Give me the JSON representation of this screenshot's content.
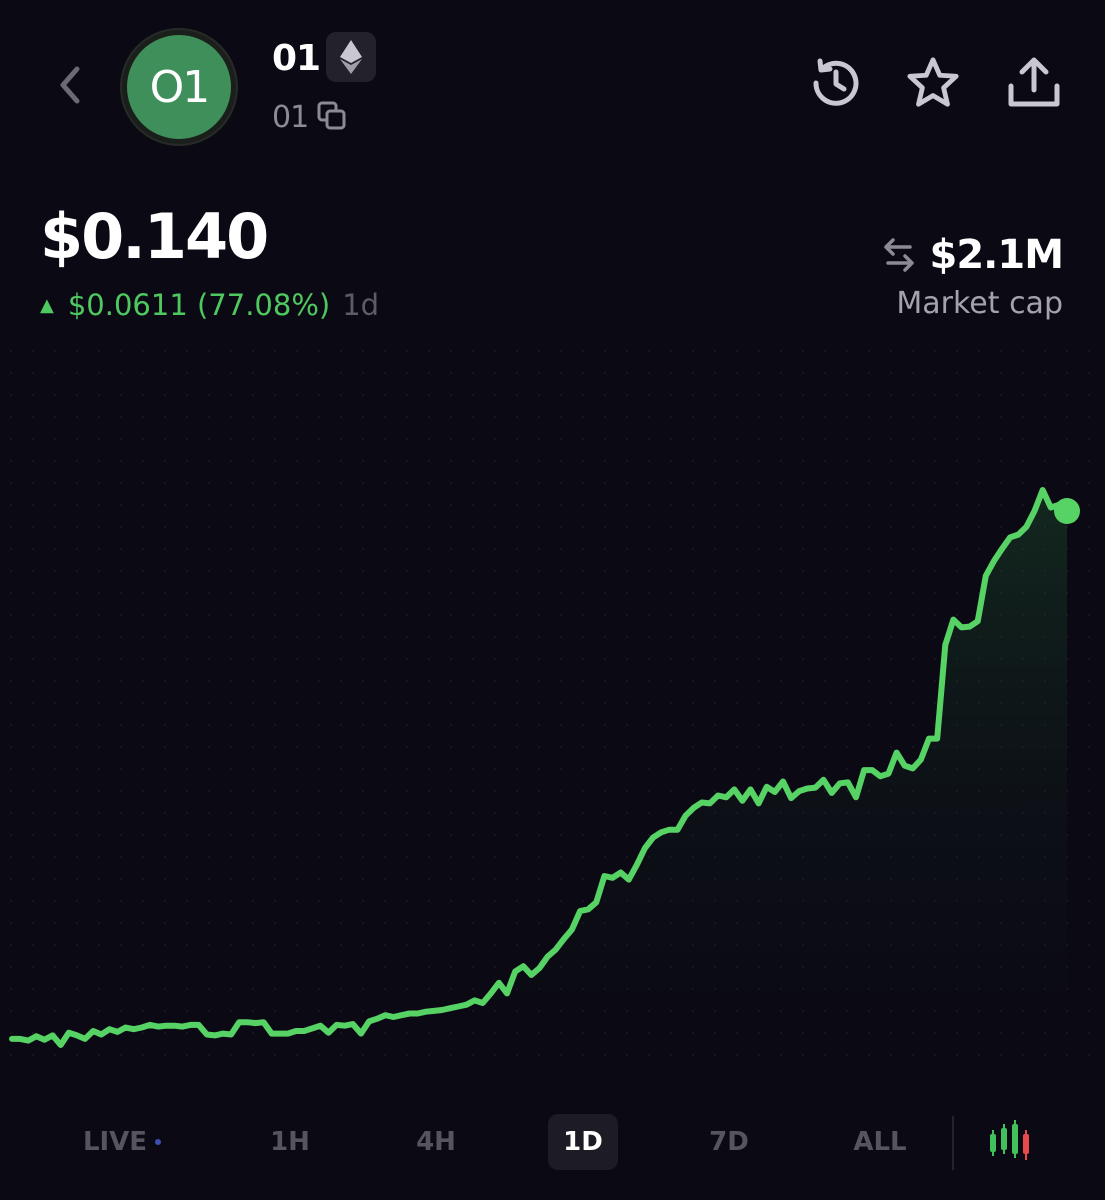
{
  "header": {
    "token_name": "01",
    "token_symbol": "01",
    "avatar_text": "O1",
    "chain_icon": "ethereum-icon",
    "icons": [
      "back-chevron-icon",
      "history-icon",
      "star-icon",
      "share-icon",
      "copy-icon"
    ]
  },
  "price": {
    "current": "$0.140",
    "change_value": "$0.0611 (77.08%)",
    "period": "1d"
  },
  "market_cap": {
    "value": "$2.1M",
    "label": "Market cap",
    "icon": "swap-arrows-icon"
  },
  "chart_data": {
    "type": "area",
    "title": "",
    "xlabel": "",
    "ylabel": "",
    "grid": true,
    "line_color": "#56d364",
    "y": [
      0.0797,
      0.0797,
      0.0795,
      0.08,
      0.0796,
      0.0801,
      0.079,
      0.0804,
      0.0801,
      0.0797,
      0.0806,
      0.0802,
      0.0808,
      0.0805,
      0.081,
      0.0808,
      0.081,
      0.0813,
      0.0811,
      0.0812,
      0.0812,
      0.0811,
      0.0813,
      0.0813,
      0.0802,
      0.0801,
      0.0803,
      0.0802,
      0.0816,
      0.0816,
      0.0815,
      0.0816,
      0.0803,
      0.0803,
      0.0803,
      0.0806,
      0.0806,
      0.0809,
      0.0812,
      0.0804,
      0.0813,
      0.0812,
      0.0814,
      0.0803,
      0.0817,
      0.082,
      0.0824,
      0.0822,
      0.0824,
      0.0826,
      0.0826,
      0.0828,
      0.0829,
      0.083,
      0.0832,
      0.0834,
      0.0836,
      0.0841,
      0.0838,
      0.0849,
      0.0861,
      0.0849,
      0.0874,
      0.088,
      0.087,
      0.0878,
      0.0891,
      0.0899,
      0.0911,
      0.0922,
      0.0943,
      0.0945,
      0.0953,
      0.0983,
      0.0981,
      0.0987,
      0.0979,
      0.0996,
      0.1015,
      0.1027,
      0.1033,
      0.1036,
      0.1036,
      0.1052,
      0.1061,
      0.1067,
      0.1066,
      0.1075,
      0.1073,
      0.1082,
      0.1069,
      0.1082,
      0.1066,
      0.1085,
      0.1079,
      0.1091,
      0.1072,
      0.108,
      0.1083,
      0.1084,
      0.1093,
      0.1078,
      0.1089,
      0.109,
      0.1073,
      0.1104,
      0.1104,
      0.1097,
      0.11,
      0.1124,
      0.1109,
      0.1106,
      0.1116,
      0.114,
      0.114,
      0.1247,
      0.1276,
      0.1267,
      0.1268,
      0.1274,
      0.1326,
      0.1343,
      0.1357,
      0.137,
      0.1373,
      0.1382,
      0.14,
      0.1424,
      0.1404,
      0.1407,
      0.14
    ]
  },
  "time_tabs": [
    {
      "label": "LIVE",
      "active": false,
      "live": true
    },
    {
      "label": "1H",
      "active": false
    },
    {
      "label": "4H",
      "active": false
    },
    {
      "label": "1D",
      "active": true
    },
    {
      "label": "7D",
      "active": false
    },
    {
      "label": "ALL",
      "active": false
    }
  ],
  "chart_toggle_icon": "candlestick-chart-icon",
  "colors": {
    "background": "#0b0a14",
    "positive": "#4fc85f",
    "avatar": "#3f8f5b",
    "candle_green": "#41c15b",
    "candle_red": "#e8494c"
  }
}
